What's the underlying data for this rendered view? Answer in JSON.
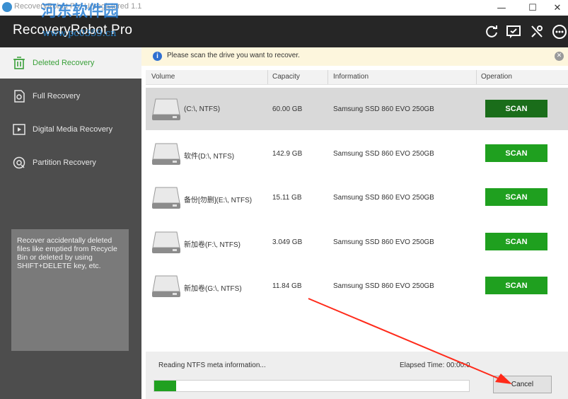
{
  "window": {
    "title": "RecoveryRobot Pro Unregistered 1.1",
    "watermark": "河东软件园",
    "watermark_url": "www.pc0359.cn",
    "minimize": "—",
    "maximize": "☐",
    "close": "✕"
  },
  "header": {
    "brand": "RecoveryRobot Pro"
  },
  "sidebar": {
    "items": [
      {
        "label": "Deleted Recovery",
        "icon": "trash-icon"
      },
      {
        "label": "Full Recovery",
        "icon": "file-recover-icon"
      },
      {
        "label": "Digital Media Recovery",
        "icon": "media-icon"
      },
      {
        "label": "Partition Recovery",
        "icon": "partition-icon"
      }
    ],
    "description": "Recover accidentally deleted files like emptied from Recycle Bin or deleted by using SHIFT+DELETE key, etc."
  },
  "notice": {
    "text": "Please scan the drive you want to recover."
  },
  "table": {
    "headers": [
      "Volume",
      "Capacity",
      "Information",
      "Operation"
    ],
    "rows": [
      {
        "volume": "(C:\\, NTFS)",
        "capacity": "60.00 GB",
        "info": "Samsung SSD 860 EVO 250GB",
        "action": "SCAN"
      },
      {
        "volume": "软件(D:\\, NTFS)",
        "capacity": "142.9 GB",
        "info": "Samsung SSD 860 EVO 250GB",
        "action": "SCAN"
      },
      {
        "volume": "备份[勿删](E:\\, NTFS)",
        "capacity": "15.11 GB",
        "info": "Samsung SSD 860 EVO 250GB",
        "action": "SCAN"
      },
      {
        "volume": "新加卷(F:\\, NTFS)",
        "capacity": "3.049 GB",
        "info": "Samsung SSD 860 EVO 250GB",
        "action": "SCAN"
      },
      {
        "volume": "新加卷(G:\\, NTFS)",
        "capacity": "11.84 GB",
        "info": "Samsung SSD 860 EVO 250GB",
        "action": "SCAN"
      }
    ]
  },
  "status": {
    "text": "Reading NTFS meta information...",
    "elapsed": "Elapsed Time: 00:00:0",
    "progress": 0.07,
    "cancel_label": "Cancel"
  },
  "colors": {
    "accent": "#1fa01f",
    "header": "#262626",
    "sidebar": "#4d4d4d",
    "annotation": "#ff2a1a"
  }
}
